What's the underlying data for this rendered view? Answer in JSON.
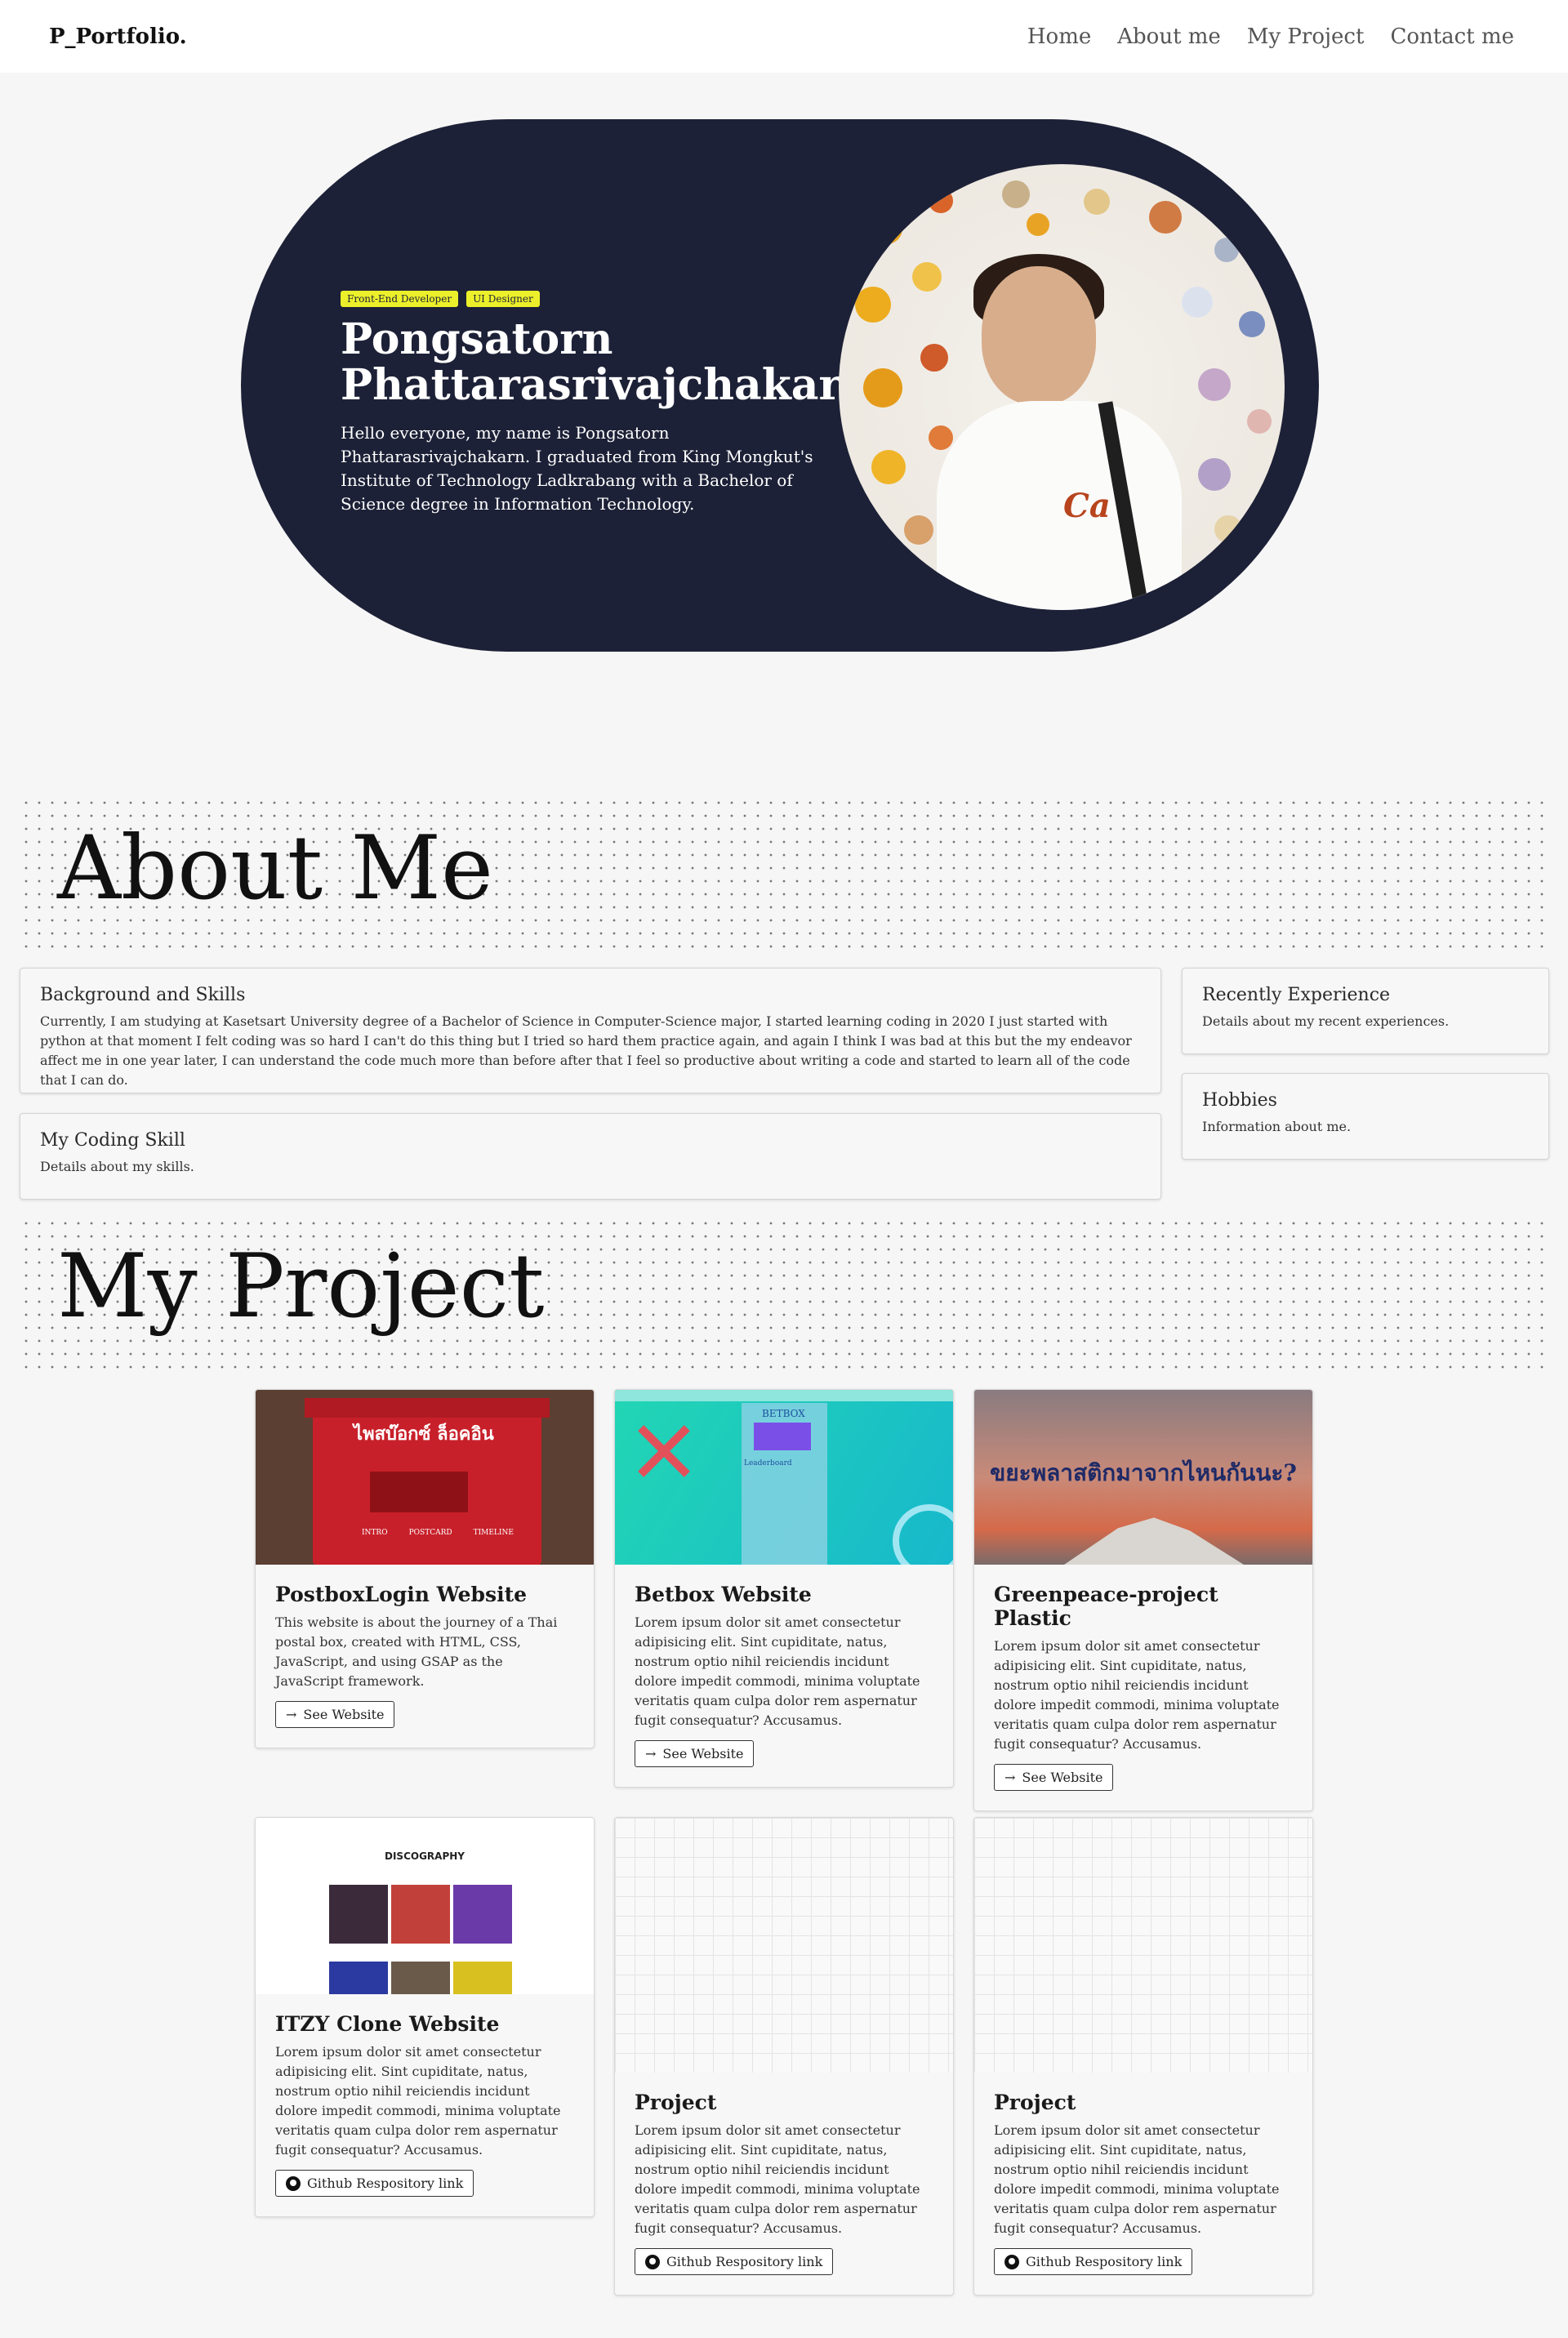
{
  "nav": {
    "brand": "P_Portfolio.",
    "links": [
      "Home",
      "About me",
      "My Project",
      "Contact me"
    ]
  },
  "hero": {
    "tags": [
      "Front-End Developer",
      "UI Designer"
    ],
    "name_line1": "Pongsatorn",
    "name_line2": "Phattarasrivajchakarn",
    "description": "Hello everyone, my name is Pongsatorn Phattarasrivajchakarn. I graduated from King Mongkut's Institute of Technology Ladkrabang with a Bachelor of Science degree in Information Technology.",
    "photo_icon": "profile-photo",
    "shirt_logo": "Ca"
  },
  "about": {
    "title": "About Me",
    "cards": [
      {
        "title": "Background and Skills",
        "text": "Currently, I am studying at Kasetsart University degree of a Bachelor of Science in Computer-Science major, I started learning coding in 2020 I just started with python at that moment I felt coding was so hard I can't do this thing but I tried so hard them practice again, and again I think I was bad at this but the my endeavor affect me in one year later, I can understand the code much more than before after that I feel so productive about writing a code and started to learn all of the code that I can do."
      },
      {
        "title": "My Coding Skill",
        "text": "Details about my skills."
      },
      {
        "title": "Recently Experience",
        "text": "Details about my recent experiences."
      },
      {
        "title": "Hobbies",
        "text": "Information about me."
      }
    ]
  },
  "projects": {
    "title": "My Project",
    "items": [
      {
        "title": "PostboxLogin Website",
        "text": "This website is about the journey of a Thai postal box, created with HTML, CSS, JavaScript, and using GSAP as the JavaScript framework.",
        "button": "See Website",
        "thumb_title": "ไพสบ๊อกซ์ ล็อคอิน",
        "thumb_links": [
          "INTRO",
          "POSTCARD",
          "TIMELINE"
        ]
      },
      {
        "title": "Betbox Website",
        "text": "Lorem ipsum dolor sit amet consectetur adipisicing elit. Sint cupiditate, natus, nostrum optio nihil reiciendis incidunt dolore impedit commodi, minima voluptate veritatis quam culpa dolor rem aspernatur fugit consequatur? Accusamus.",
        "button": "See Website",
        "thumb_title": "BETBOX",
        "thumb_sub": "Leaderboard"
      },
      {
        "title": "Greenpeace-project Plastic",
        "text": "Lorem ipsum dolor sit amet consectetur adipisicing elit. Sint cupiditate, natus, nostrum optio nihil reiciendis incidunt dolore impedit commodi, minima voluptate veritatis quam culpa dolor rem aspernatur fugit consequatur? Accusamus.",
        "button": "See Website",
        "thumb_title": "ขยะพลาสติกมาจากไหนกันนะ?"
      },
      {
        "title": "ITZY Clone Website",
        "text": "Lorem ipsum dolor sit amet consectetur adipisicing elit. Sint cupiditate, natus, nostrum optio nihil reiciendis incidunt dolore impedit commodi, minima voluptate veritatis quam culpa dolor rem aspernatur fugit consequatur? Accusamus.",
        "button": "Github Respository link",
        "thumb_title": "DISCOGRAPHY"
      },
      {
        "title": "Project",
        "text": "Lorem ipsum dolor sit amet consectetur adipisicing elit. Sint cupiditate, natus, nostrum optio nihil reiciendis incidunt dolore impedit commodi, minima voluptate veritatis quam culpa dolor rem aspernatur fugit consequatur? Accusamus.",
        "button": "Github Respository link"
      },
      {
        "title": "Project",
        "text": "Lorem ipsum dolor sit amet consectetur adipisicing elit. Sint cupiditate, natus, nostrum optio nihil reiciendis incidunt dolore impedit commodi, minima voluptate veritatis quam culpa dolor rem aspernatur fugit consequatur? Accusamus.",
        "button": "Github Respository link"
      }
    ]
  },
  "colors": {
    "hero_bg": "#1d2137",
    "tag_bg": "#ecf02a",
    "page_bg": "#f6f6f6"
  }
}
